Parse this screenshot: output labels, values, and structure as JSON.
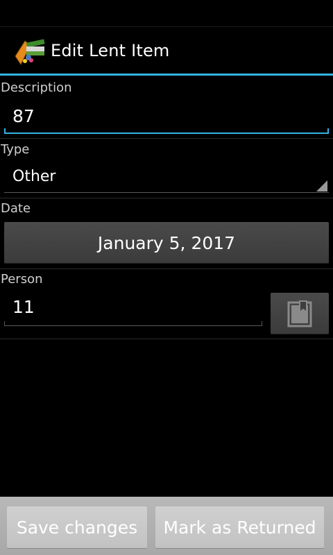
{
  "app": {
    "title": "Edit Lent Item"
  },
  "form": {
    "description": {
      "label": "Description",
      "value": "87"
    },
    "type": {
      "label": "Type",
      "value": "Other"
    },
    "date": {
      "label": "Date",
      "value": "January 5, 2017"
    },
    "person": {
      "label": "Person",
      "value": "11"
    }
  },
  "actions": {
    "save_label": "Save changes",
    "returned_label": "Mark as Returned"
  },
  "colors": {
    "accent": "#33b5e5",
    "background": "#000000",
    "button": "#404040"
  }
}
